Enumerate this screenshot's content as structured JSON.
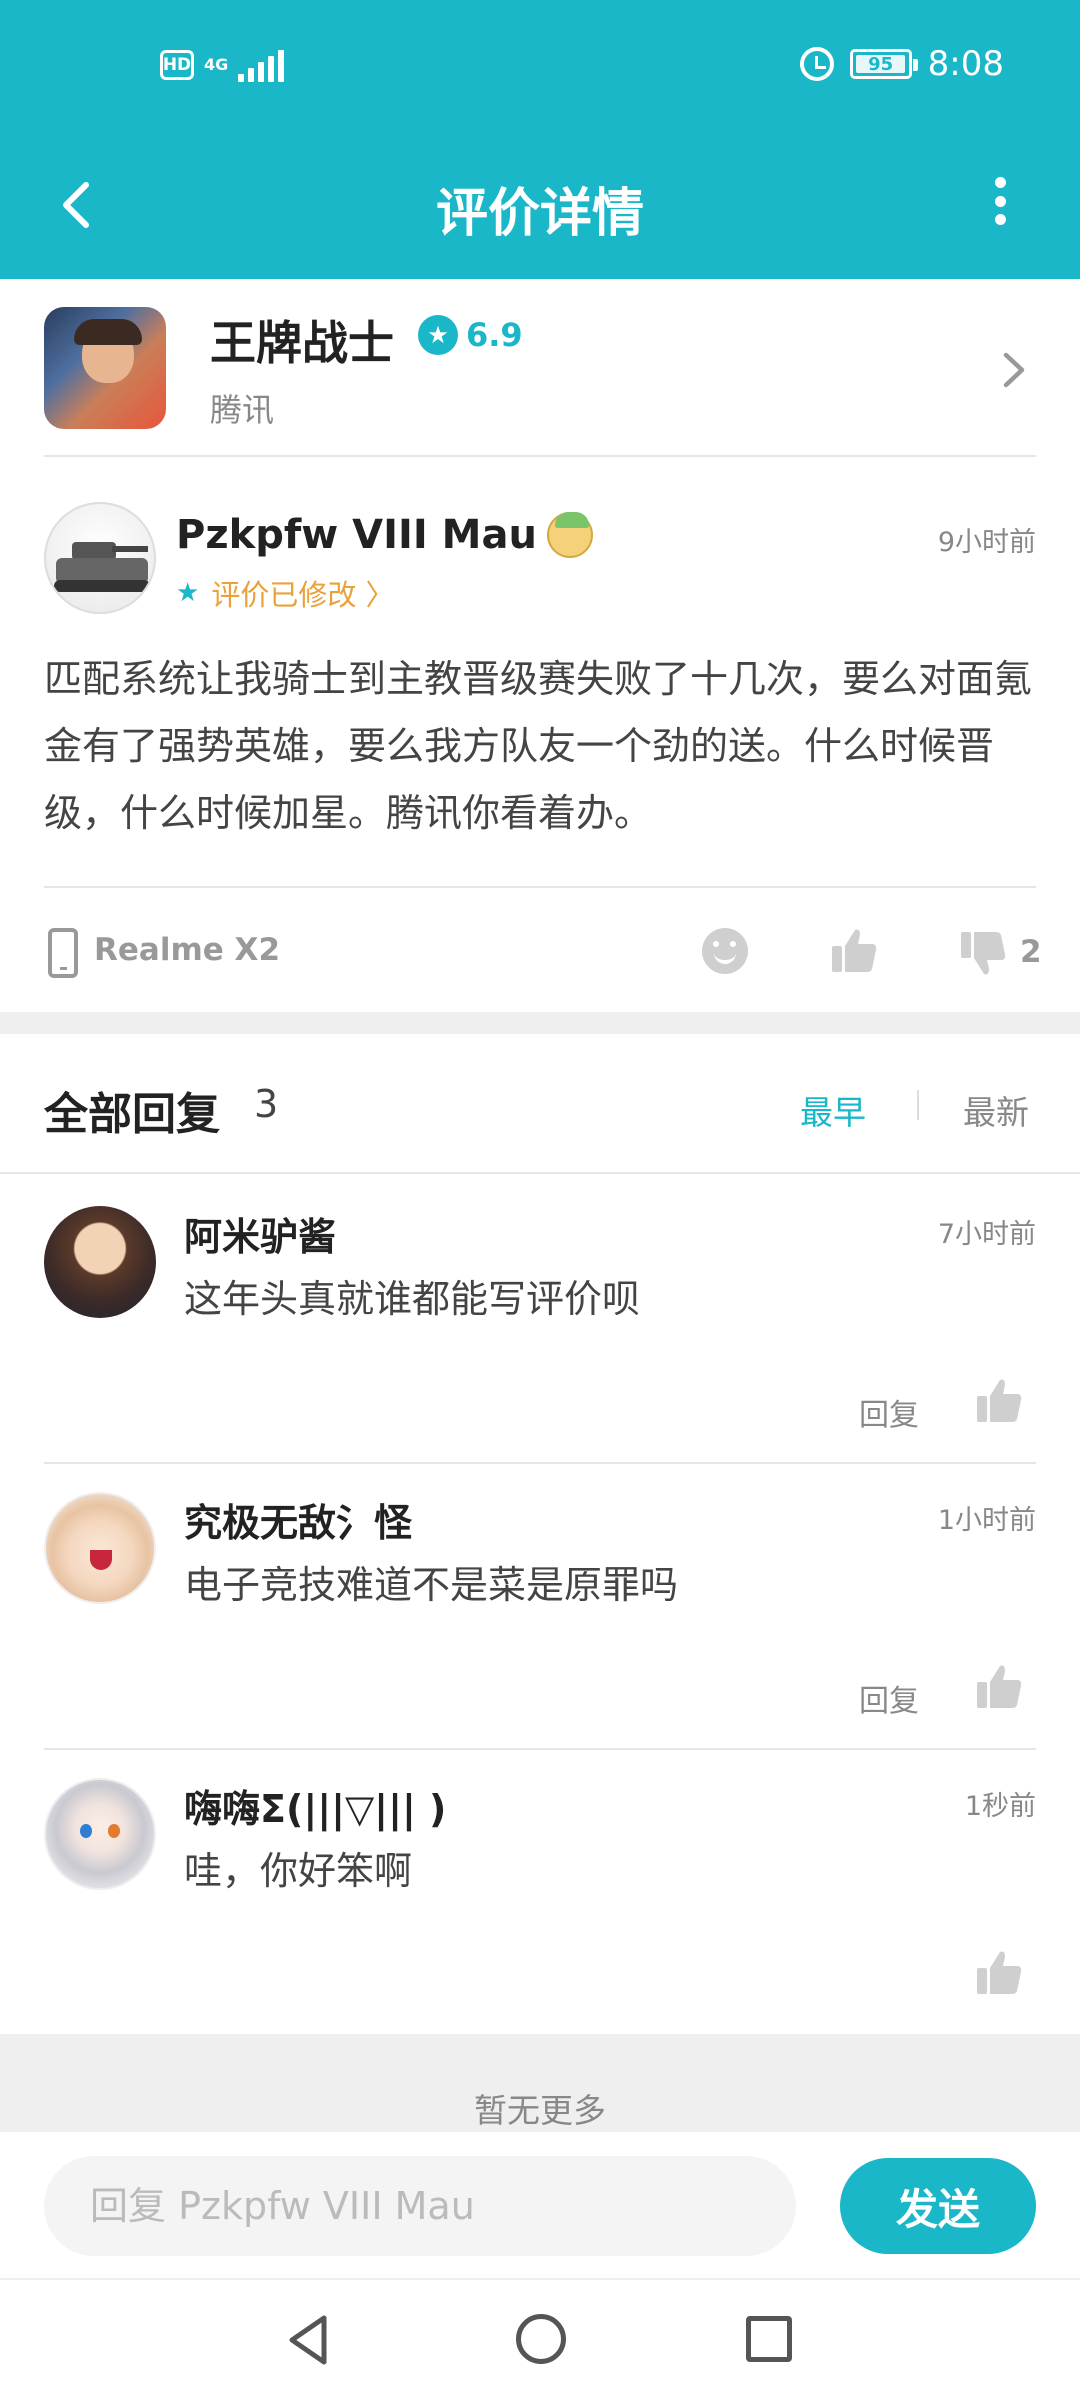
{
  "status_bar": {
    "hd": "HD",
    "network": "4G",
    "battery": "95",
    "time": "8:08"
  },
  "nav": {
    "title": "评价详情"
  },
  "app": {
    "name": "王牌战士",
    "score": "6.9",
    "publisher": "腾讯"
  },
  "review": {
    "username": "Pzkpfw VIII Mau",
    "edited_label": "评价已修改 〉",
    "time": "9小时前",
    "text": "匹配系统让我骑士到主教晋级赛失败了十几次，要么对面氪金有了强势英雄，要么我方队友一个劲的送。什么时候晋级，什么时候加星。腾讯你看着办。",
    "device": "Realme X2",
    "dislike_count": "2"
  },
  "replies": {
    "title": "全部回复",
    "count": "3",
    "sort_early": "最早",
    "sort_new": "最新",
    "reply_label": "回复",
    "items": [
      {
        "name": "阿米驴酱",
        "time": "7小时前",
        "text": "这年头真就谁都能写评价呗"
      },
      {
        "name": "究极无敌氵怪",
        "time": "1小时前",
        "text": "电子竞技难道不是菜是原罪吗"
      },
      {
        "name": "嗨嗨Σ(|||▽||| )",
        "time": "1秒前",
        "text": "哇，你好笨啊"
      }
    ],
    "no_more": "暂无更多"
  },
  "input": {
    "placeholder": "回复 Pzkpfw VIII Mau",
    "send_label": "发送"
  },
  "colors": {
    "accent": "#19b7c8",
    "edited": "#e9a23b"
  }
}
